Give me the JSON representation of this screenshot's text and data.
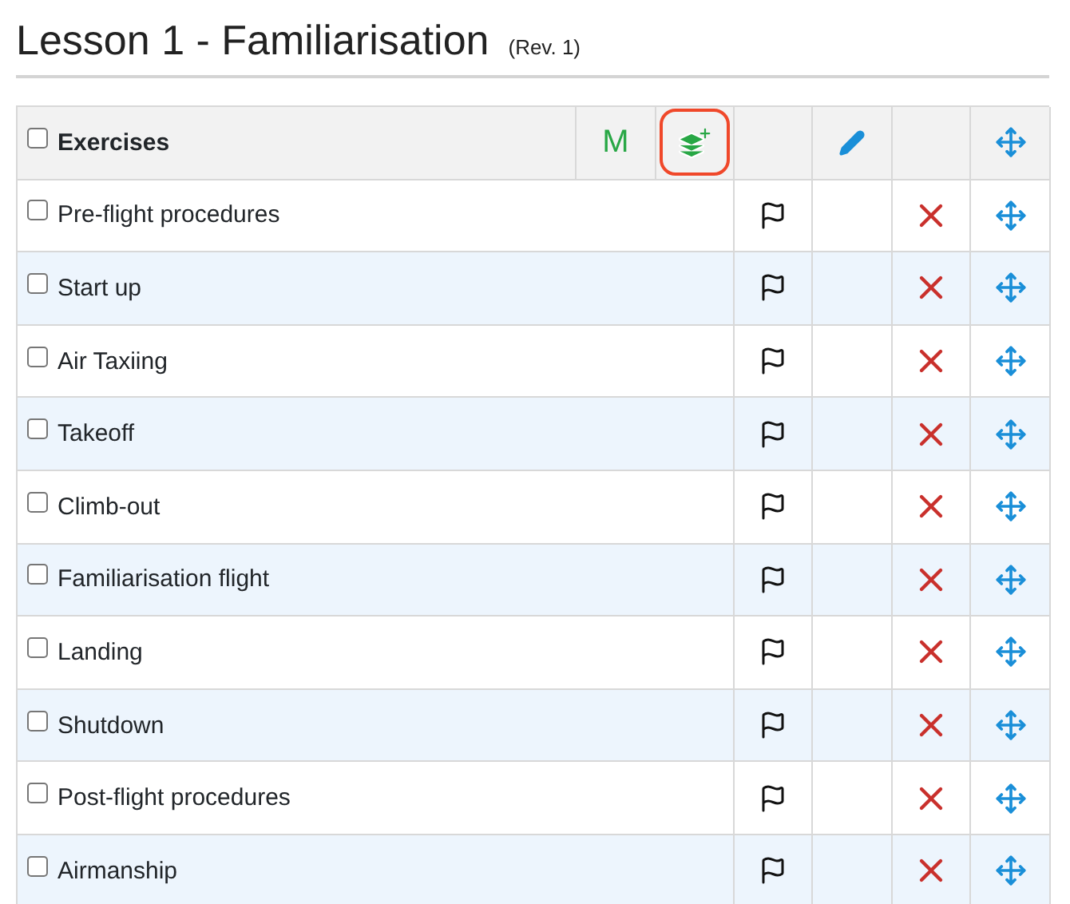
{
  "title": "Lesson 1 - Familiarisation",
  "revision": "(Rev. 1)",
  "header": {
    "label": "Exercises",
    "checked": false,
    "tools": [
      {
        "kind": "text",
        "label": "M"
      },
      {
        "kind": "add-layers",
        "highlighted": true
      },
      {
        "kind": "blank"
      },
      {
        "kind": "edit"
      },
      {
        "kind": "blank"
      },
      {
        "kind": "move"
      }
    ]
  },
  "rows": [
    {
      "label": "Pre-flight procedures",
      "checked": false
    },
    {
      "label": "Start up",
      "checked": false
    },
    {
      "label": "Air Taxiing",
      "checked": false
    },
    {
      "label": "Takeoff",
      "checked": false
    },
    {
      "label": "Climb-out",
      "checked": false
    },
    {
      "label": "Familiarisation flight",
      "checked": false
    },
    {
      "label": "Landing",
      "checked": false
    },
    {
      "label": "Shutdown",
      "checked": false
    },
    {
      "label": "Post-flight procedures",
      "checked": false
    },
    {
      "label": "Airmanship",
      "checked": false
    }
  ]
}
